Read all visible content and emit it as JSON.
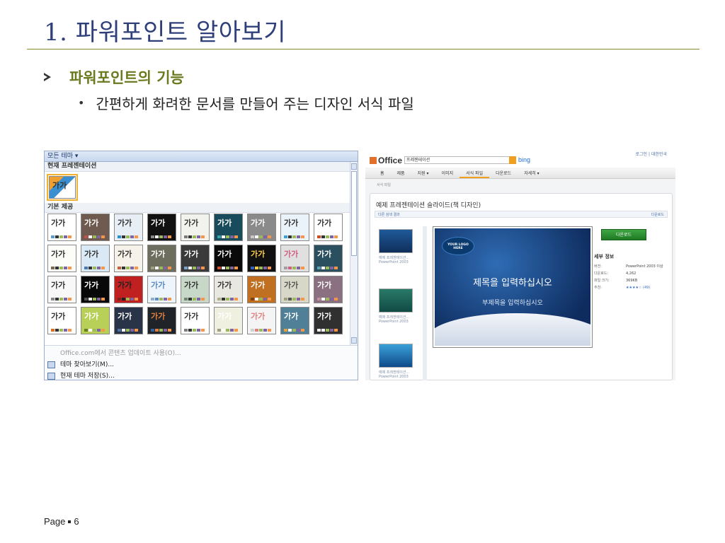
{
  "slide": {
    "title": "1. 파워포인트 알아보기",
    "bullet_1": "파워포인트의 기능",
    "bullet_2": "간편하게 화려한 문서를 만들어 주는 디자인 서식 파일",
    "page_label": "Page",
    "page_number": "6"
  },
  "gallery": {
    "top_label": "모든 테마 ▾",
    "current_section": "현재 프레젠테이션",
    "builtin_section": "기본 제공",
    "current_thumb_text": "가가",
    "thumbs": [
      {
        "text": "가가",
        "bg": "#ffffff",
        "fg": "#333333",
        "accent": "#5a9bd5"
      },
      {
        "text": "가가",
        "bg": "#6e5a4e",
        "fg": "#ffffff",
        "accent": "#c0504d"
      },
      {
        "text": "가가",
        "bg": "#e8eef6",
        "fg": "#333333",
        "accent": "#2a8fd0"
      },
      {
        "text": "가가",
        "bg": "#111111",
        "fg": "#ffffff",
        "accent": "#888888"
      },
      {
        "text": "가가",
        "bg": "#f3f3ee",
        "fg": "#333333",
        "accent": "#7a7a7a"
      },
      {
        "text": "가가",
        "bg": "#184c5c",
        "fg": "#ffffff",
        "accent": "#38a3b0"
      },
      {
        "text": "가가",
        "bg": "#8a8a8a",
        "fg": "#ffffff",
        "accent": "#c8c8c8"
      },
      {
        "text": "가가",
        "bg": "#eaf3fa",
        "fg": "#333333",
        "accent": "#3fa0d0"
      },
      {
        "text": "가가",
        "bg": "#ffffff",
        "fg": "#333333",
        "accent": "#d04a20"
      },
      {
        "text": "가가",
        "bg": "#fcfcf8",
        "fg": "#333333",
        "accent": "#7a6a50"
      },
      {
        "text": "가가",
        "bg": "#d9e9f5",
        "fg": "#333333",
        "accent": "#4a7ab0"
      },
      {
        "text": "가가",
        "bg": "#f6f2ea",
        "fg": "#333333",
        "accent": "#c06040"
      },
      {
        "text": "가가",
        "bg": "#6e6e5e",
        "fg": "#ffffff",
        "accent": "#a0a080"
      },
      {
        "text": "가가",
        "bg": "#3a3a3a",
        "fg": "#ffffff",
        "accent": "#7aa0d0"
      },
      {
        "text": "가가",
        "bg": "#0a0a0a",
        "fg": "#ffffff",
        "accent": "#d05030"
      },
      {
        "text": "가가",
        "bg": "#101010",
        "fg": "#ffd040",
        "accent": "#3060c0"
      },
      {
        "text": "가가",
        "bg": "#e0e0e0",
        "fg": "#d06080",
        "accent": "#a0a0a0"
      },
      {
        "text": "가가",
        "bg": "#2a5060",
        "fg": "#ffffff",
        "accent": "#60a0b0"
      },
      {
        "text": "가가",
        "bg": "#f8f8f8",
        "fg": "#333333",
        "accent": "#888888"
      },
      {
        "text": "가가",
        "bg": "#080808",
        "fg": "#ffffff",
        "accent": "#505050"
      },
      {
        "text": "가가",
        "bg": "#c02020",
        "fg": "#222222",
        "accent": "#802020"
      },
      {
        "text": "가가",
        "bg": "#eef4fb",
        "fg": "#5a8ac0",
        "accent": "#90b0d0"
      },
      {
        "text": "가가",
        "bg": "#c8d8c8",
        "fg": "#333333",
        "accent": "#708870"
      },
      {
        "text": "가가",
        "bg": "#e8e8e0",
        "fg": "#333333",
        "accent": "#b0b090"
      },
      {
        "text": "가가",
        "bg": "#c07020",
        "fg": "#ffffff",
        "accent": "#804010"
      },
      {
        "text": "가가",
        "bg": "#d8d8c8",
        "fg": "#555555",
        "accent": "#a0a080"
      },
      {
        "text": "가가",
        "bg": "#8a7080",
        "fg": "#ffffff",
        "accent": "#c090a0"
      },
      {
        "text": "가가",
        "bg": "#ffffff",
        "fg": "#333333",
        "accent": "#e07020"
      },
      {
        "text": "가가",
        "bg": "#b8d058",
        "fg": "#ffffff",
        "accent": "#6a8020"
      },
      {
        "text": "가가",
        "bg": "#2a3448",
        "fg": "#ffffff",
        "accent": "#5070a0"
      },
      {
        "text": "가가",
        "bg": "#202428",
        "fg": "#e08040",
        "accent": "#3060a0"
      },
      {
        "text": "가가",
        "bg": "#ffffff",
        "fg": "#333333",
        "accent": "#808080"
      },
      {
        "text": "가가",
        "bg": "#f0f0e0",
        "fg": "#ffffff",
        "accent": "#a0a080"
      },
      {
        "text": "가가",
        "bg": "#f4f4f4",
        "fg": "#e08080",
        "accent": "#d0d0d0"
      },
      {
        "text": "가가",
        "bg": "#508098",
        "fg": "#ffffff",
        "accent": "#e0a040"
      },
      {
        "text": "가가",
        "bg": "#303030",
        "fg": "#ffffff",
        "accent": "#f0f0f0"
      }
    ],
    "menu": [
      {
        "label": "Office.com에서 콘텐츠 업데이트 사용(O)...",
        "disabled": true
      },
      {
        "label": "테마 찾아보기(M)...",
        "disabled": false
      },
      {
        "label": "현재 테마 저장(S)...",
        "disabled": false
      }
    ]
  },
  "office_site": {
    "logo": "Office",
    "search_value": "프레젠테이션",
    "bing": "bing",
    "toplinks": "로그인 | 대한민국",
    "nav": [
      "홈",
      "제품",
      "지원 ▾",
      "이미지",
      "서식 파일",
      "다운로드",
      "자세히 ▾"
    ],
    "active_nav": "서식 파일",
    "breadcrumb": "서식 파일",
    "panel_title": "예제 프레젠테이션 슬라이드(책 디자인)",
    "subbar_left": "다른 검색 결과",
    "subbar_right": "다운로드",
    "thumb_captions": [
      "예제 프레젠테이션... PowerPoint 2003",
      "예제 프레젠테이션... PowerPoint 2003",
      "예제 프레젠테이션... PowerPoint 2003"
    ],
    "preview": {
      "logo": "YOUR LOGO HERE",
      "title": "제목을 입력하십시오",
      "subtitle": "부제목을 입력하십시오"
    },
    "download_label": "다운로드",
    "details_title": "세부 정보",
    "details": [
      {
        "k": "버전:",
        "v": "PowerPoint 2003 이상"
      },
      {
        "k": "다운로드:",
        "v": "4,262"
      },
      {
        "k": "파일 크기:",
        "v": "369KB"
      },
      {
        "k": "추천:",
        "v": "★★★★☆ (49)"
      }
    ]
  }
}
